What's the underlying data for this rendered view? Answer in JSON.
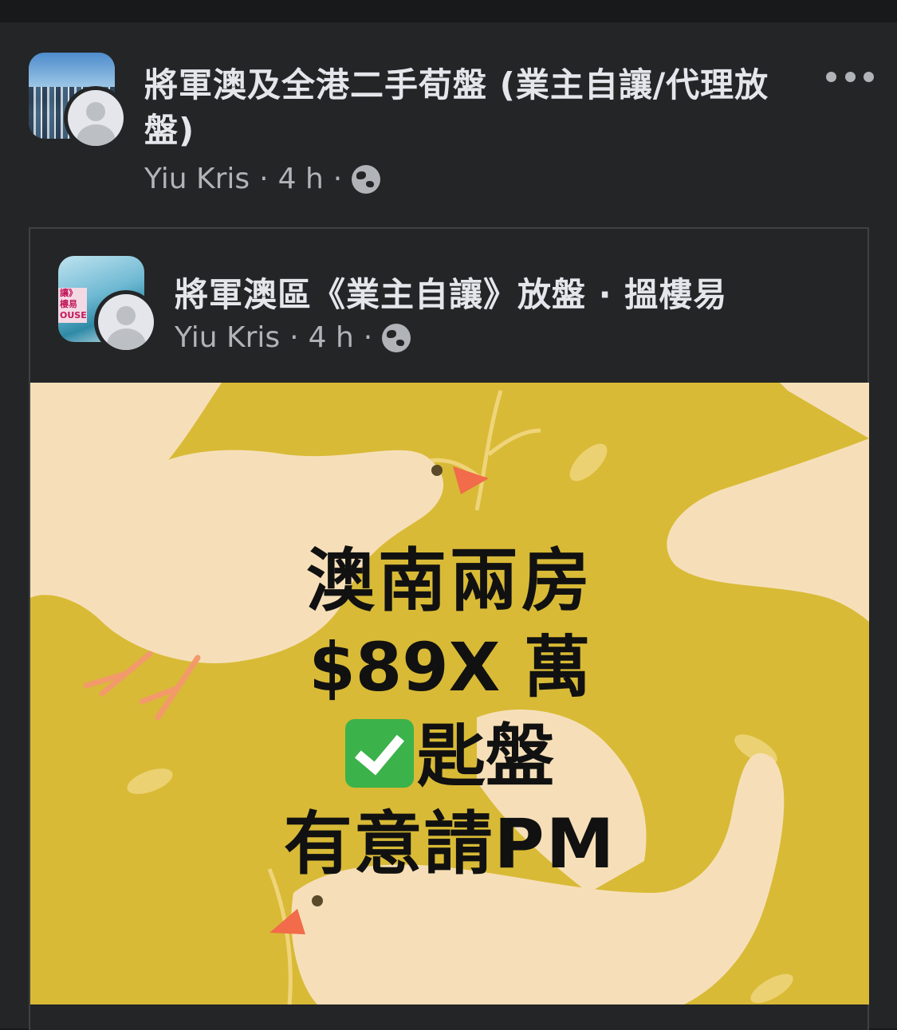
{
  "post": {
    "group_name": "將軍澳及全港二手荀盤 (業主自讓/代理放盤)",
    "author": "Yiu Kris",
    "time": "4 h",
    "separator": "·"
  },
  "shared_post": {
    "group_name": "將軍澳區《業主自讓》放盤 · 搵樓易",
    "author": "Yiu Kris",
    "time": "4 h",
    "separator": "·",
    "avatar_tag": [
      "讓》",
      "樓易",
      "OUSE"
    ]
  },
  "image_text": {
    "line1": "澳南兩房",
    "line2": "$89X 萬",
    "line3": "匙盤",
    "line4": "有意請PM"
  },
  "icons": {
    "more": "more-options-icon",
    "globe": "globe-icon",
    "check": "check-mark-icon"
  },
  "colors": {
    "background": "#242526",
    "image_bg": "#d8ba36",
    "dove": "#f6dfb8",
    "beak": "#f26b4a",
    "check": "#3bb24a"
  }
}
